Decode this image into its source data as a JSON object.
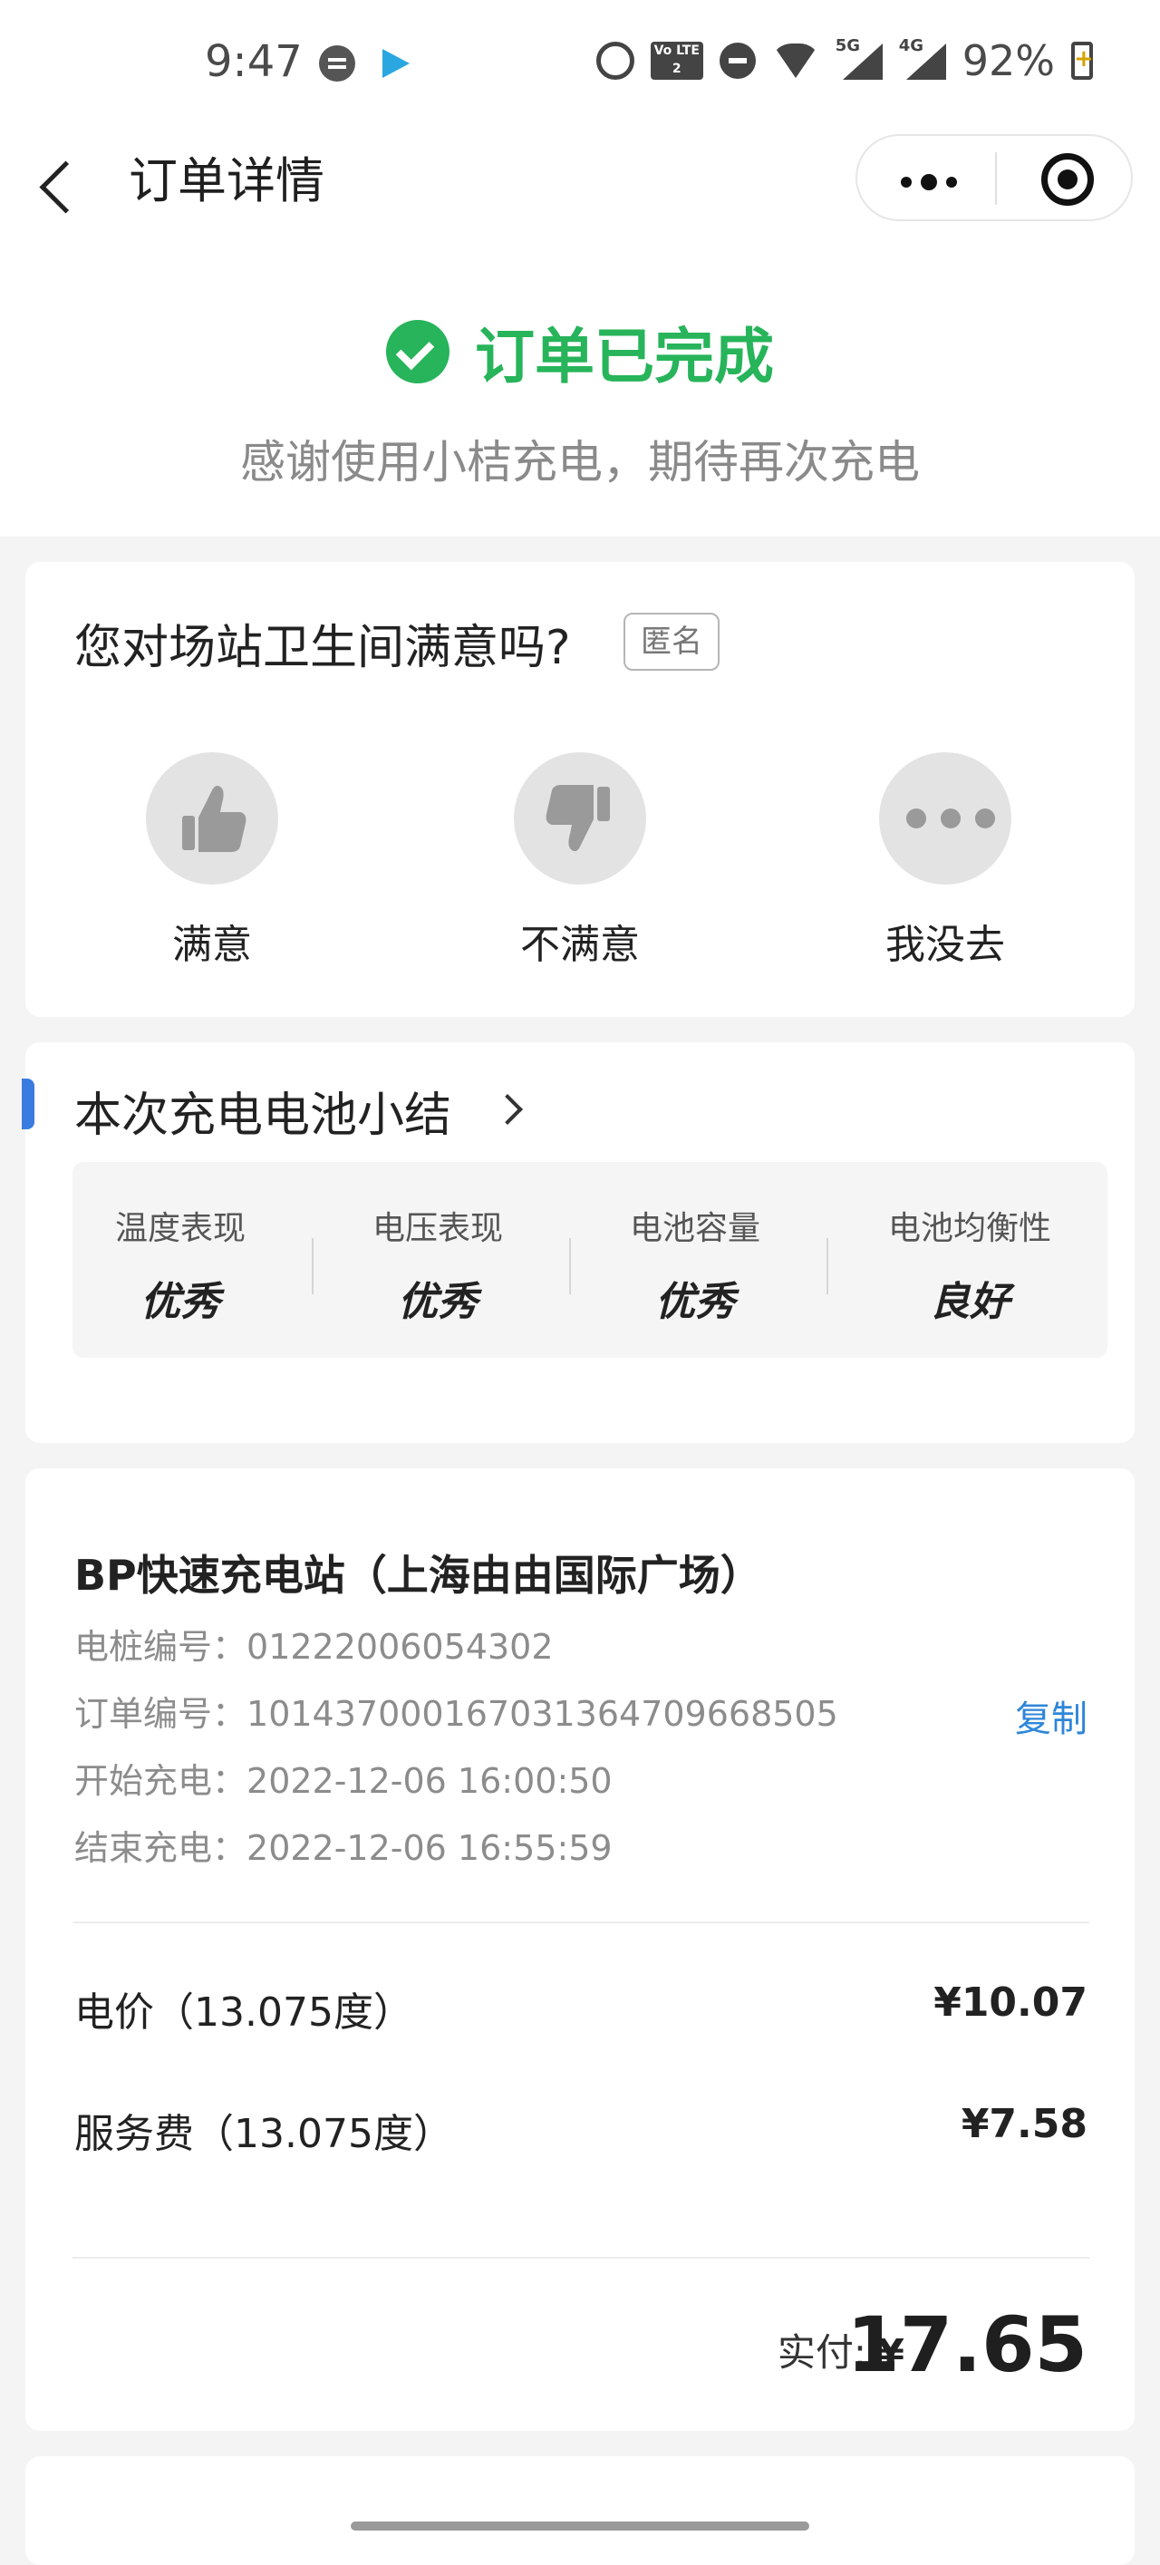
{
  "status_bar": {
    "time": "9:47",
    "network_4g": "4G",
    "network_5g": "5G",
    "volte": "Vo LTE 2",
    "battery": "92%",
    "icons": [
      "chat-icon",
      "video-play-icon",
      "alarm-icon",
      "volte-icon",
      "dnd-icon",
      "wifi-icon",
      "signal-5g-icon",
      "signal-4g-icon",
      "battery-icon"
    ]
  },
  "nav": {
    "title": "订单详情",
    "icons": [
      "back-arrow-icon",
      "more-dots-icon",
      "close-target-icon"
    ]
  },
  "header": {
    "status": "订单已完成",
    "subtitle": "感谢使用小桔充电，期待再次充电",
    "status_color": "#27b45a"
  },
  "survey": {
    "question": "您对场站卫生间满意吗?",
    "anonymous": "匿名",
    "options": [
      {
        "label": "满意",
        "icon": "thumbs-up-icon"
      },
      {
        "label": "不满意",
        "icon": "thumbs-down-icon"
      },
      {
        "label": "我没去",
        "icon": "more-dots-icon"
      }
    ]
  },
  "battery_summary": {
    "title": "本次充电电池小结",
    "accent": "#3a7be0",
    "metrics": [
      {
        "label": "温度表现",
        "value": "优秀"
      },
      {
        "label": "电压表现",
        "value": "优秀"
      },
      {
        "label": "电池容量",
        "value": "优秀"
      },
      {
        "label": "电池均衡性",
        "value": "良好"
      }
    ]
  },
  "order": {
    "station": "BP快速充电站（上海由由国际广场）",
    "rows": [
      {
        "label": "电桩编号：",
        "value": "01222006054302"
      },
      {
        "label": "订单编号：",
        "value": "1014370001670313647096685​05"
      },
      {
        "label": "开始充电：",
        "value": "2022-12-06 16:00:50"
      },
      {
        "label": "结束充电：",
        "value": "2022-12-06 16:55:59"
      }
    ],
    "copy": "复制",
    "fees": [
      {
        "label": "电价（13.075度）",
        "amount": "¥10.07"
      },
      {
        "label": "服务费（13.075度）",
        "amount": "¥7.58"
      }
    ],
    "paid_label": "实付:",
    "currency": "¥",
    "paid_amount": "17.65",
    "link_color": "#2f86d8"
  }
}
